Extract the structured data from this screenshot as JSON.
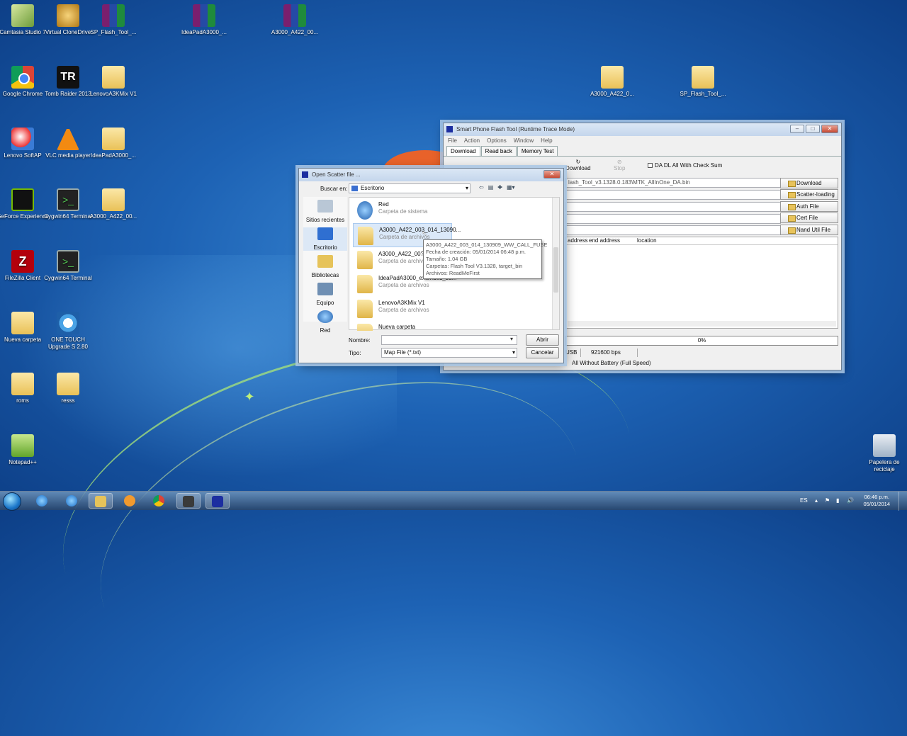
{
  "desktop_icons": [
    {
      "label": "Camtasia Studio 7",
      "icon": "camtasia-icon"
    },
    {
      "label": "Virtual CloneDrive",
      "icon": "virtual-clonedrive-icon"
    },
    {
      "label": "SP_Flash_Tool_...",
      "icon": "winrar-archive-icon"
    },
    {
      "label": "IdeaPadA3000_...",
      "icon": "winrar-archive-icon"
    },
    {
      "label": "A3000_A422_00...",
      "icon": "winrar-archive-icon"
    },
    {
      "label": "Google Chrome",
      "icon": "chrome-icon"
    },
    {
      "label": "Tomb Raider 2013",
      "icon": "tomb-raider-icon"
    },
    {
      "label": "LenovoA3KMix V1",
      "icon": "folder-icon"
    },
    {
      "label": "A3000_A422_0...",
      "icon": "folder-icon"
    },
    {
      "label": "SP_Flash_Tool_...",
      "icon": "folder-icon"
    },
    {
      "label": "Lenovo SoftAP",
      "icon": "lenovo-softap-icon"
    },
    {
      "label": "VLC media player",
      "icon": "vlc-icon"
    },
    {
      "label": "IdeaPadA3000_...",
      "icon": "folder-icon"
    },
    {
      "label": "GeForce Experience",
      "icon": "geforce-icon"
    },
    {
      "label": "Cygwin64 Terminal",
      "icon": "cygwin-terminal-icon"
    },
    {
      "label": "A3000_A422_00...",
      "icon": "folder-icon"
    },
    {
      "label": "FileZilla Client",
      "icon": "filezilla-icon"
    },
    {
      "label": "Cygwin64 Terminal",
      "icon": "cygwin-terminal-icon"
    },
    {
      "label": "Nueva carpeta",
      "icon": "folder-icon"
    },
    {
      "label": "ONE TOUCH Upgrade S 2.80",
      "icon": "gear-icon"
    },
    {
      "label": "roms",
      "icon": "folder-icon"
    },
    {
      "label": "resss",
      "icon": "folder-icon"
    },
    {
      "label": "Notepad++",
      "icon": "notepad-plus-icon"
    },
    {
      "label": "Papelera de reciclaje",
      "icon": "recycle-bin-icon"
    }
  ],
  "flash_tool": {
    "title": "Smart Phone Flash Tool (Runtime Trace Mode)",
    "menu": [
      "File",
      "Action",
      "Options",
      "Window",
      "Help"
    ],
    "tabs": [
      "Download",
      "Read back",
      "Memory Test"
    ],
    "toolbar_download": "Download",
    "toolbar_stop": "Stop",
    "checksum_label": "DA DL All With Check Sum",
    "da_path": "lash_Tool_v3.1328.0.183\\MTK_AllInOne_DA.bin",
    "side_buttons": [
      "Download Agent",
      "Scatter-loading",
      "Auth File",
      "Cert File",
      "Nand Util File"
    ],
    "columns": [
      "address",
      "end address",
      "location"
    ],
    "progress": "0%",
    "status": [
      "USB",
      "921600 bps"
    ],
    "mode": "All Without Battery (Full Speed)"
  },
  "dialog": {
    "title": "Open Scatter file ...",
    "look_in_label": "Buscar en:",
    "look_in_value": "Escritorio",
    "places": [
      "Sitios recientes",
      "Escritorio",
      "Bibliotecas",
      "Equipo",
      "Red"
    ],
    "files": [
      {
        "name": "Red",
        "type": "Carpeta de sistema"
      },
      {
        "name": "A3000_A422_003_014_13090...",
        "type": "Carpeta de archivos"
      },
      {
        "name": "A3000_A422_00?_0",
        "type": "Carpeta de archivos"
      },
      {
        "name": "IdeaPadA3000_extended_bu...",
        "type": "Carpeta de archivos"
      },
      {
        "name": "LenovoA3KMix V1",
        "type": "Carpeta de archivos"
      },
      {
        "name": "Nueva carpeta",
        "type": "Carpeta de archivos"
      }
    ],
    "tooltip": [
      "A3000_A422_003_014_130909_WW_CALL_FUSE",
      "Fecha de creación: 05/01/2014 06:48 p.m.",
      "Tamaño: 1.04 GB",
      "Carpetas: Flash Tool V3.1328, target_bin",
      "Archivos: ReadMeFirst"
    ],
    "name_label": "Nombre:",
    "name_value": "",
    "type_label": "Tipo:",
    "type_value": "Map File (*.txt)",
    "open_button": "Abrir",
    "cancel_button": "Cancelar"
  },
  "taskbar": {
    "lang": "ES",
    "time": "06:46 p.m.",
    "date": "05/01/2014"
  }
}
